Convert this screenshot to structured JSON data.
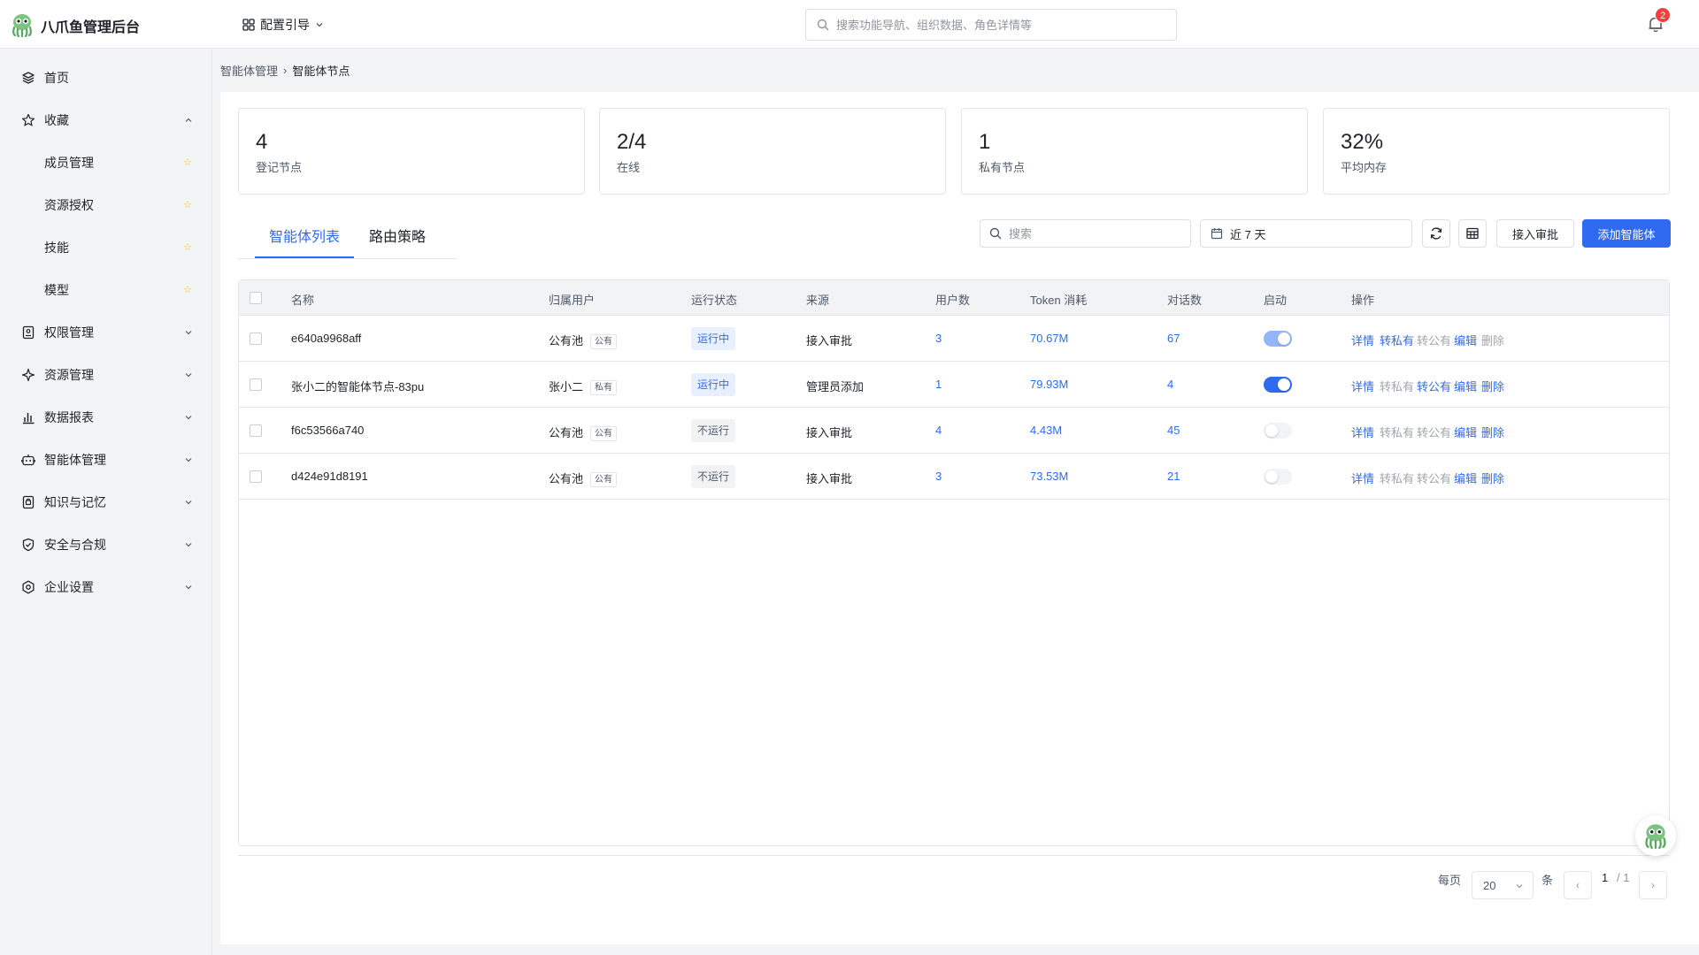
{
  "app": {
    "title": "八爪鱼管理后台"
  },
  "header": {
    "guide_label": "配置引导",
    "search_placeholder": "搜索功能导航、组织数据、角色详情等",
    "notification_count": "2"
  },
  "sidebar": {
    "items": [
      {
        "label": "首页",
        "icon": "layers-icon"
      },
      {
        "label": "收藏",
        "icon": "star-icon",
        "expanded": true
      },
      {
        "label": "成员管理",
        "sub": true,
        "starred": true
      },
      {
        "label": "资源授权",
        "sub": true,
        "starred": true
      },
      {
        "label": "技能",
        "sub": true,
        "starred": true
      },
      {
        "label": "模型",
        "sub": true,
        "starred": true
      },
      {
        "label": "权限管理",
        "icon": "permission-icon"
      },
      {
        "label": "资源管理",
        "icon": "sparkle-icon"
      },
      {
        "label": "数据报表",
        "icon": "bar-chart-icon"
      },
      {
        "label": "智能体管理",
        "icon": "robot-icon"
      },
      {
        "label": "知识与记忆",
        "icon": "knowledge-icon"
      },
      {
        "label": "安全与合规",
        "icon": "shield-icon"
      },
      {
        "label": "企业设置",
        "icon": "settings-icon"
      }
    ]
  },
  "breadcrumb": {
    "parent": "智能体管理",
    "current": "智能体节点"
  },
  "stats": [
    {
      "value": "4",
      "label": "登记节点"
    },
    {
      "value": "2/4",
      "label": "在线"
    },
    {
      "value": "1",
      "label": "私有节点"
    },
    {
      "value": "32%",
      "label": "平均内存"
    }
  ],
  "tabs": [
    {
      "label": "智能体列表",
      "active": true
    },
    {
      "label": "路由策略",
      "active": false
    }
  ],
  "toolbar": {
    "search_placeholder": "搜索",
    "date_range": "近 7 天",
    "approve_label": "接入审批",
    "add_label": "添加智能体"
  },
  "table": {
    "columns": [
      "名称",
      "归属用户",
      "运行状态",
      "来源",
      "用户数",
      "Token 消耗",
      "对话数",
      "启动",
      "操作"
    ],
    "rows": [
      {
        "name": "e640a9968aff",
        "owner": "公有池",
        "owner_tag": "公有",
        "status": "运行中",
        "running": true,
        "source": "接入审批",
        "users": "3",
        "tokens": "70.67M",
        "chats": "67",
        "toggle": "on-dim",
        "actions": [
          {
            "label": "详情",
            "enabled": true
          },
          {
            "label": "转私有",
            "enabled": true
          },
          {
            "label": "转公有",
            "enabled": false
          },
          {
            "label": "编辑",
            "enabled": true
          },
          {
            "label": "删除",
            "enabled": false
          }
        ]
      },
      {
        "name": "张小二的智能体节点-83pu",
        "owner": "张小二",
        "owner_tag": "私有",
        "status": "运行中",
        "running": true,
        "source": "管理员添加",
        "users": "1",
        "tokens": "79.93M",
        "chats": "4",
        "toggle": "on",
        "actions": [
          {
            "label": "详情",
            "enabled": true
          },
          {
            "label": "转私有",
            "enabled": false
          },
          {
            "label": "转公有",
            "enabled": true
          },
          {
            "label": "编辑",
            "enabled": true
          },
          {
            "label": "删除",
            "enabled": true
          }
        ]
      },
      {
        "name": "f6c53566a740",
        "owner": "公有池",
        "owner_tag": "公有",
        "status": "不运行",
        "running": false,
        "source": "接入审批",
        "users": "4",
        "tokens": "4.43M",
        "chats": "45",
        "toggle": "off",
        "actions": [
          {
            "label": "详情",
            "enabled": true
          },
          {
            "label": "转私有",
            "enabled": false
          },
          {
            "label": "转公有",
            "enabled": false
          },
          {
            "label": "编辑",
            "enabled": true
          },
          {
            "label": "删除",
            "enabled": true
          }
        ]
      },
      {
        "name": "d424e91d8191",
        "owner": "公有池",
        "owner_tag": "公有",
        "status": "不运行",
        "running": false,
        "source": "接入审批",
        "users": "3",
        "tokens": "73.53M",
        "chats": "21",
        "toggle": "off",
        "actions": [
          {
            "label": "详情",
            "enabled": true
          },
          {
            "label": "转私有",
            "enabled": false
          },
          {
            "label": "转公有",
            "enabled": false
          },
          {
            "label": "编辑",
            "enabled": true
          },
          {
            "label": "删除",
            "enabled": true
          }
        ]
      }
    ]
  },
  "pagination": {
    "per_page_label": "每页",
    "page_size": "20",
    "unit_label": "条",
    "current": "1",
    "total": "/ 1"
  },
  "colors": {
    "primary": "#2f6bf0",
    "danger": "#f53f3f",
    "star": "#f7ba1e"
  }
}
